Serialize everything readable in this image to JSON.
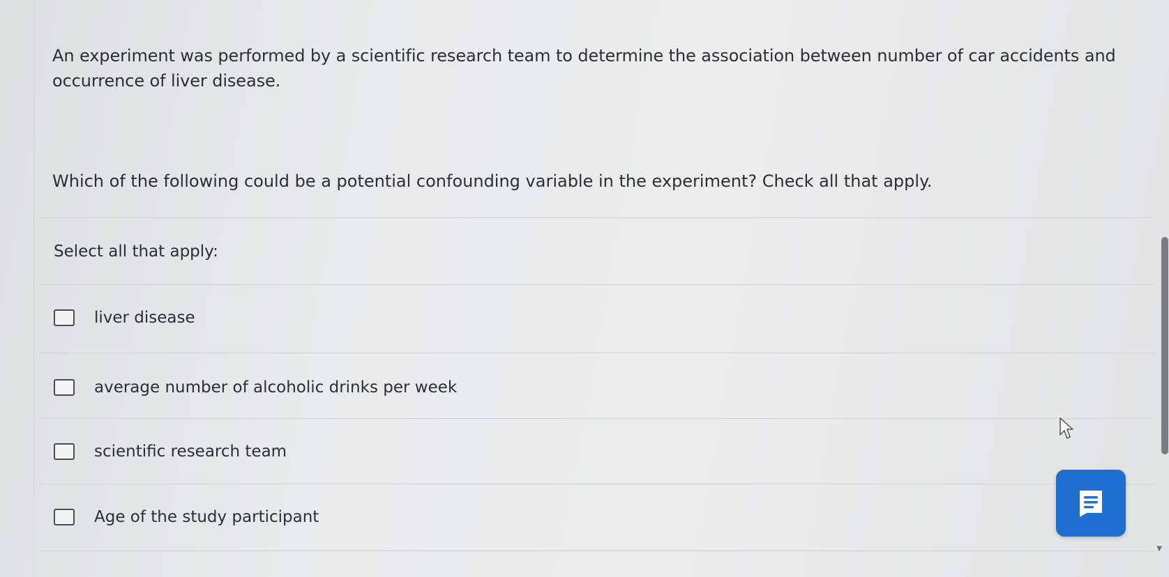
{
  "question": {
    "passage": "An experiment was performed by a scientific research team to determine the association between number of car accidents and occurrence of liver disease.",
    "prompt": "Which of the following could be a potential confounding variable in the experiment?  Check all that apply.",
    "instruction": "Select all that apply:"
  },
  "options": [
    {
      "label": "liver disease",
      "checked": false
    },
    {
      "label": "average number of alcoholic drinks per week",
      "checked": false
    },
    {
      "label": "scientific research team",
      "checked": false
    },
    {
      "label": "Age of the study participant",
      "checked": false
    }
  ],
  "chat_button": {
    "icon": "chat-lines-icon",
    "color": "#1f6fd1"
  },
  "colors": {
    "accent": "#1f6fd1",
    "text": "#2c2f33"
  }
}
